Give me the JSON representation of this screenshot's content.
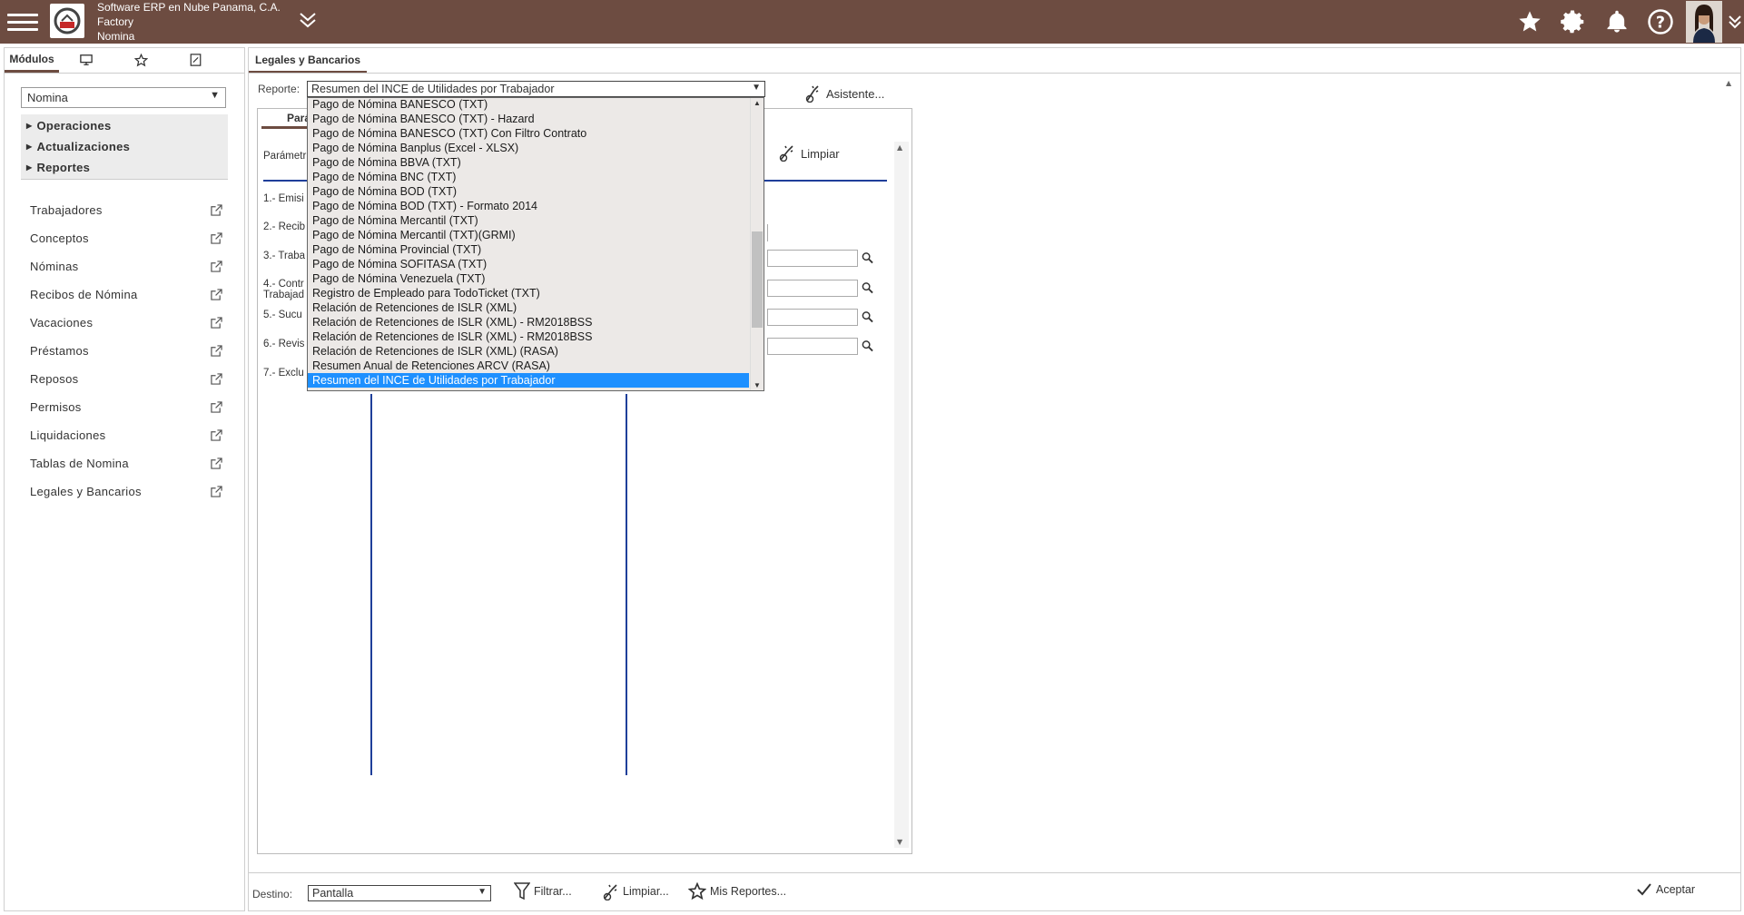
{
  "header": {
    "company_line1": "Software ERP en Nube Panama, C.A.",
    "company_line2": "Factory",
    "company_line3": "Nomina"
  },
  "left": {
    "tabs": [
      "Módulos"
    ],
    "module_value": "Nomina",
    "accordion": [
      "Operaciones",
      "Actualizaciones",
      "Reportes"
    ],
    "items": [
      "Trabajadores",
      "Conceptos",
      "Nóminas",
      "Recibos de Nómina",
      "Vacaciones",
      "Préstamos",
      "Reposos",
      "Permisos",
      "Liquidaciones",
      "Tablas de Nomina",
      "Legales y Bancarios"
    ]
  },
  "main": {
    "tab": "Legales y Bancarios",
    "reporte_label": "Reporte:",
    "reporte_value": "Resumen del INCE de Utilidades por Trabajador",
    "asistente": "Asistente...",
    "inner_tab": "Pará",
    "params_label": "Parámetr",
    "limpiar": "Limpiar",
    "params": [
      "1.- Emisi",
      "2.- Recib",
      "3.- Traba",
      "4.- Contr",
      "Trabajad",
      "5.- Sucu",
      "6.- Revis",
      "7.- Exclu"
    ]
  },
  "dropdown": {
    "items": [
      "Pago de Nómina BANESCO (TXT)",
      "Pago de Nómina BANESCO (TXT) - Hazard",
      "Pago de Nómina BANESCO (TXT) Con Filtro Contrato",
      "Pago de Nómina Banplus (Excel - XLSX)",
      "Pago de Nómina BBVA (TXT)",
      "Pago de Nómina BNC (TXT)",
      "Pago de Nómina BOD (TXT)",
      "Pago de Nómina BOD (TXT) - Formato 2014",
      "Pago de Nómina Mercantil (TXT)",
      "Pago de Nómina Mercantil (TXT)(GRMI)",
      "Pago de Nómina Provincial (TXT)",
      "Pago de Nómina SOFITASA (TXT)",
      "Pago de Nómina Venezuela (TXT)",
      "Registro de Empleado para TodoTicket (TXT)",
      "Relación de Retenciones de ISLR (XML)",
      "Relación de Retenciones de ISLR (XML) - RM2018BSS",
      "Relación de Retenciones de ISLR (XML) - RM2018BSS",
      "Relación de Retenciones de ISLR (XML) (RASA)",
      "Resumen Anual de Retenciones ARCV (RASA)",
      "Resumen del INCE de Utilidades por Trabajador"
    ],
    "selected_index": 19
  },
  "bottom": {
    "destino_label": "Destino:",
    "destino_value": "Pantalla",
    "filtrar": "Filtrar...",
    "limpiar": "Limpiar...",
    "mis_reportes": "Mis Reportes...",
    "aceptar": "Aceptar"
  },
  "colors": {
    "header_bg": "#6d4c41",
    "accent_blue": "#1f3f9a",
    "selected": "#1e90ff"
  }
}
